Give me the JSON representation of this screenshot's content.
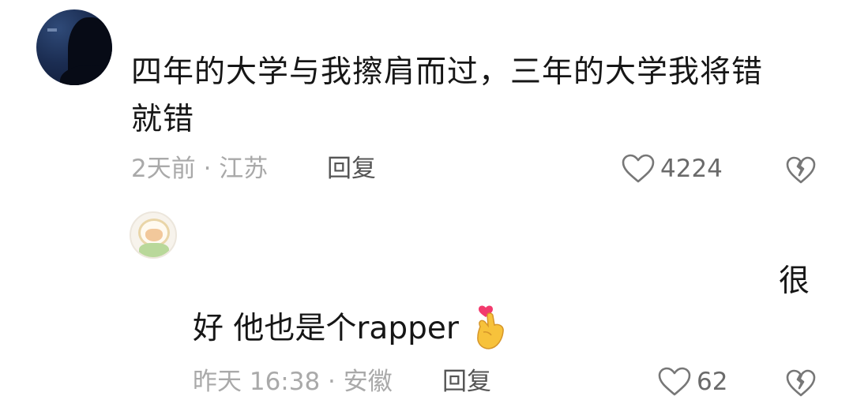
{
  "comment": {
    "text_line1": "四年的大学与我擦肩而过，三年的大学我将错",
    "text_line2": "就错",
    "meta": "2天前 · 江苏",
    "reply_label": "回复",
    "like_count": "4224"
  },
  "reply": {
    "text_tail": "很",
    "text_main": "好 他也是个rapper",
    "emoji": "heart-hands-emoji",
    "meta": "昨天 16:38 · 安徽",
    "reply_label": "回复",
    "like_count": "62"
  },
  "colors": {
    "text": "#161616",
    "meta": "#a9a9a9",
    "action": "#555555"
  }
}
